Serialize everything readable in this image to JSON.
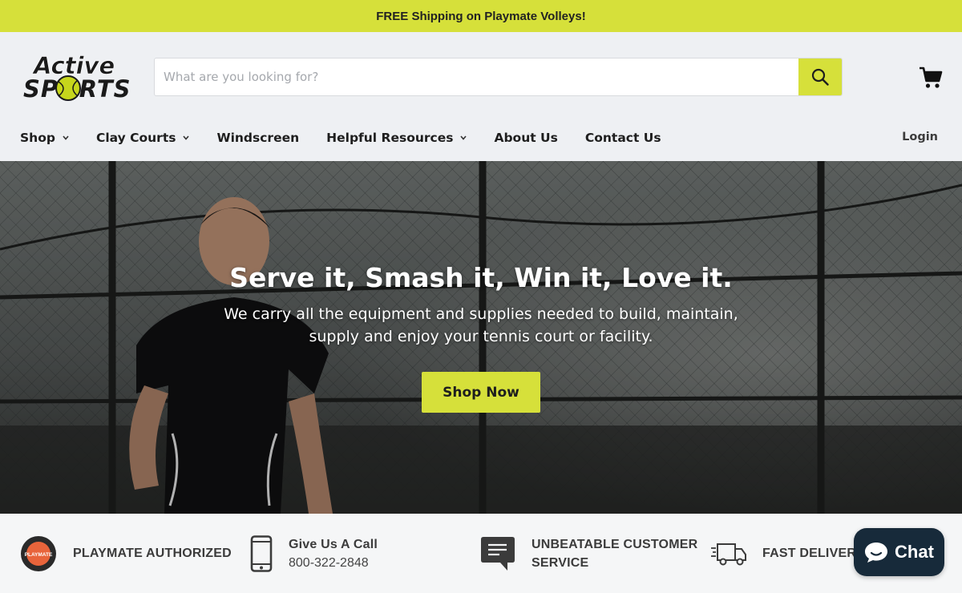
{
  "promo": {
    "text": "FREE Shipping on Playmate Volleys!"
  },
  "header": {
    "logo": {
      "line1": "Active",
      "line2": "SPORTS"
    },
    "search": {
      "placeholder": "What are you looking for?",
      "value": ""
    },
    "icons": {
      "search": "search-icon",
      "cart": "cart-icon"
    }
  },
  "nav": {
    "items": [
      {
        "label": "Shop",
        "has_dropdown": true
      },
      {
        "label": "Clay Courts",
        "has_dropdown": true
      },
      {
        "label": "Windscreen",
        "has_dropdown": false
      },
      {
        "label": "Helpful Resources",
        "has_dropdown": true
      },
      {
        "label": "About Us",
        "has_dropdown": false
      },
      {
        "label": "Contact Us",
        "has_dropdown": false
      }
    ],
    "login": "Login"
  },
  "hero": {
    "title": "Serve it, Smash it, Win it, Love it.",
    "subtitle": "We carry all the equipment and supplies needed to build, maintain, supply and enjoy your tennis court or facility.",
    "button": "Shop Now"
  },
  "features": [
    {
      "icon": "playmate-badge-icon",
      "line1": "PLAYMATE AUTHORIZED",
      "badge_text": "PLAYMATE"
    },
    {
      "icon": "phone-icon",
      "line1": "Give Us A Call",
      "line2": "800-322-2848"
    },
    {
      "icon": "chat-bubble-icon",
      "line1": "UNBEATABLE CUSTOMER",
      "line2": "SERVICE"
    },
    {
      "icon": "delivery-truck-icon",
      "line1": "FAST DELIVERY"
    }
  ],
  "chat": {
    "label": "Chat",
    "icon": "chat-bubble-icon"
  },
  "colors": {
    "accent": "#d6e03a",
    "header_bg": "#eef0f3",
    "text": "#1e1e1e",
    "chat_bg": "#172a3a"
  }
}
